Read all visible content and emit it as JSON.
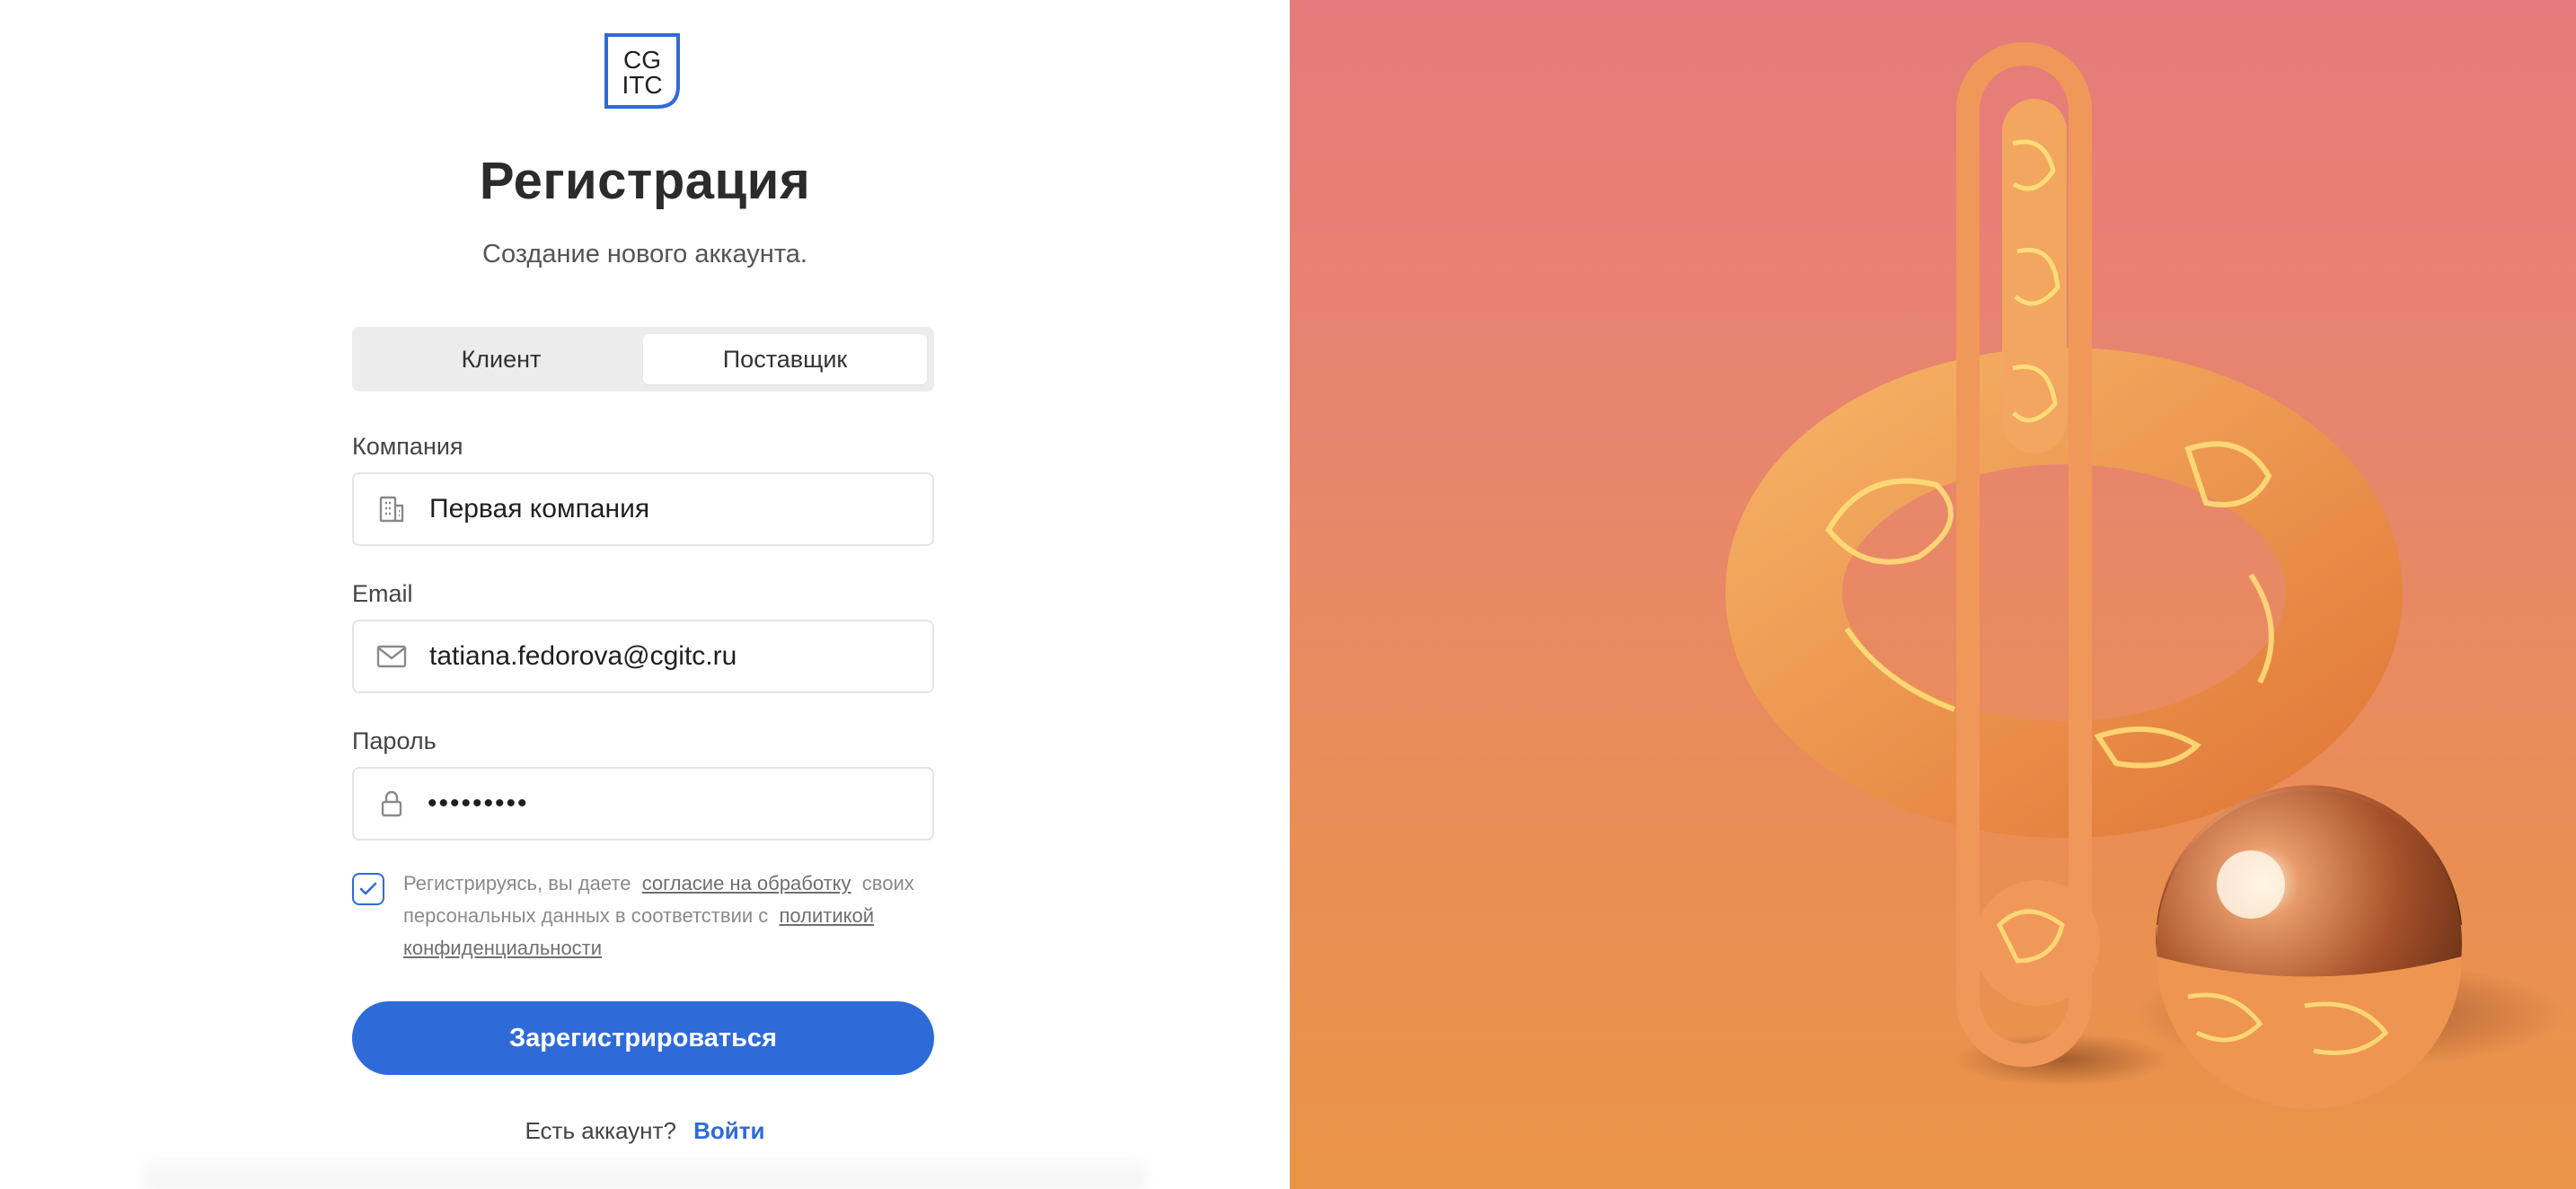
{
  "logo": {
    "line1": "CG",
    "line2": "ITC",
    "color": "#2f6bd8"
  },
  "heading": {
    "title": "Регистрация",
    "subtitle": "Создание нового аккаунта."
  },
  "tabs": [
    {
      "label": "Клиент",
      "active": false
    },
    {
      "label": "Поставщик",
      "active": true
    }
  ],
  "form": {
    "company": {
      "label": "Компания",
      "value": "Первая компания",
      "icon": "building-icon"
    },
    "email": {
      "label": "Email",
      "value": "tatiana.fedorova@cgitc.ru",
      "icon": "mail-icon"
    },
    "password": {
      "label": "Пароль",
      "value": "•••••••••",
      "icon": "lock-icon"
    }
  },
  "consent": {
    "checked": true,
    "text_1": "Регистрируясь, вы даете",
    "link_1": "согласие на обработку",
    "text_2": "своих персональных данных в соответствии с",
    "link_2": "политикой конфиденциальности"
  },
  "submit_label": "Зарегистрироваться",
  "login": {
    "prompt": "Есть аккаунт?",
    "link": "Войти"
  },
  "colors": {
    "accent": "#2f6bd8",
    "hero_top": "#e67b7b",
    "hero_bottom": "#ea9447"
  }
}
